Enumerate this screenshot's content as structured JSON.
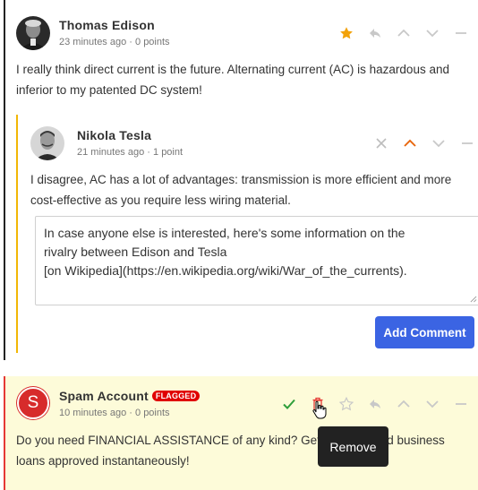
{
  "comments": [
    {
      "author": "Thomas Edison",
      "time": "23 minutes ago",
      "points": "0 points",
      "separator": "·",
      "body": "I really think direct current is the future. Alternating current (AC) is hazardous and inferior to my patented DC system!",
      "starred": true
    }
  ],
  "reply": {
    "author": "Nikola Tesla",
    "time": "21 minutes ago",
    "points": "1 point",
    "separator": "·",
    "body": "I disagree, AC has a lot of advantages: transmission is more efficient and more cost-effective as you require less wiring material.",
    "draft": "In case anyone else is interested, here's some information on the\nrivalry between Edison and Tesla\n[on Wikipedia](https://en.wikipedia.org/wiki/War_of_the_currents).",
    "submit_label": "Add Comment"
  },
  "spam": {
    "avatar_letter": "S",
    "author": "Spam Account",
    "flag_label": "FLAGGED",
    "time": "10 minutes ago",
    "points": "0 points",
    "separator": "·",
    "body": "Do you need FINANCIAL ASSISTANCE of any kind? Get personal and business loans approved instantaneously!",
    "tooltip": "Remove"
  },
  "colors": {
    "accent": "#3b64e3",
    "star": "#f2a20a",
    "upvote_active": "#e8650c",
    "approve": "#2e9e3a",
    "flag": "#e00000",
    "reply_border": "#f2b705",
    "spam_border": "#e53935",
    "spam_bg": "#fdfbd9"
  },
  "icons": [
    "star-icon",
    "reply-icon",
    "upvote-icon",
    "downvote-icon",
    "collapse-icon",
    "close-icon",
    "check-icon",
    "trash-icon"
  ]
}
